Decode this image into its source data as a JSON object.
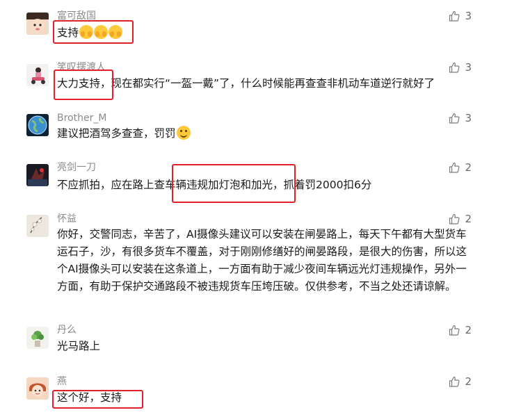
{
  "comments": [
    {
      "author": "富可敌国",
      "parts": [
        "支持"
      ],
      "likes": "3",
      "avatar": "baby-face"
    },
    {
      "author": "笑叹摆渡人",
      "parts": [
        "大力支持，现在都实行“一盔一戴”了，什么时候能再查查非机动车道逆行就好了"
      ],
      "likes": "3",
      "avatar": "scooter"
    },
    {
      "author": "Brother_M",
      "parts": [
        "建议把酒驾多查查，罚罚"
      ],
      "likes": "3",
      "avatar": "earth"
    },
    {
      "author": "亮剑一刀",
      "parts": [
        "不应抓拍，应在路上查",
        "车辆违规加灯泡和加光",
        "，抓着罚2000扣6分"
      ],
      "likes": "2",
      "avatar": "dark-figure"
    },
    {
      "author": "怀益",
      "parts": [
        "你好，交警同志，辛苦了，AI摄像头建议可以安装在闸晏路上，每天下午都有大型货车运石子，沙，有很多货车不覆盖，对于刚刚修缮好的闸晏路段，是很大的伤害，所以这个AI摄像头可以安装在这条道上，一方面有助于减少夜间车辆远光灯违规操作，另外一方面，有助于保护交通路段不被违规货车压垮压破。仅供参考，不当之处还请谅解。"
      ],
      "likes": "2",
      "avatar": "flower"
    },
    {
      "author": "丹么",
      "parts": [
        "光马路上"
      ],
      "likes": "2",
      "avatar": "plant"
    },
    {
      "author": "燕",
      "parts": [
        "这个好，支持"
      ],
      "likes": "2",
      "avatar": "cartoon-girl"
    }
  ],
  "emojis": [
    "hands-emoji",
    "smile-emoji"
  ],
  "colors": {
    "highlight": "#e41e2b",
    "author": "#8a8a8a",
    "text": "#1a1a1a",
    "like": "#6b6b6b"
  }
}
